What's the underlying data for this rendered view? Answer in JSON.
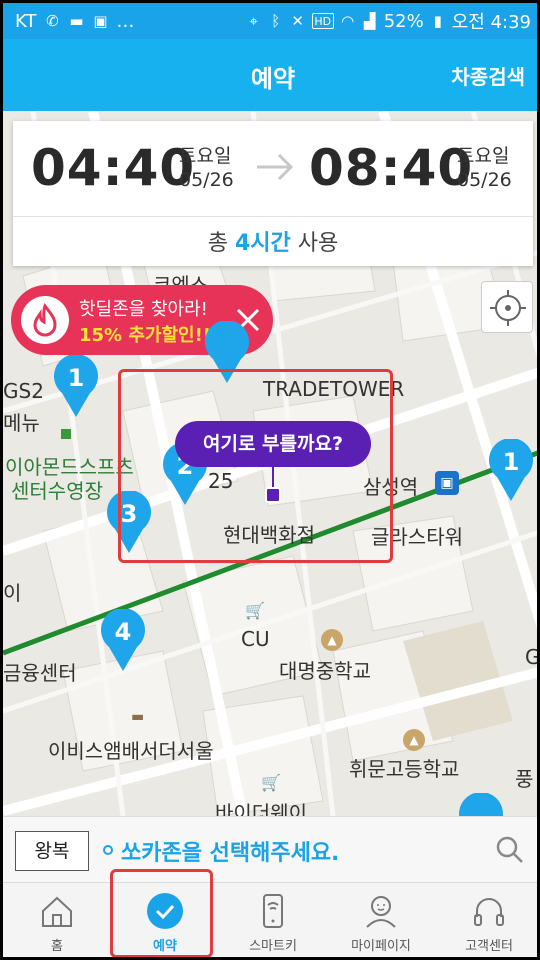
{
  "status_bar": {
    "carrier": "KT",
    "battery": "52%",
    "time": "오전 4:39"
  },
  "header": {
    "title": "예약",
    "search_label": "차종검색"
  },
  "reservation": {
    "start_time": "04:40",
    "start_day": "토요일",
    "start_date": "05/26",
    "end_time": "08:40",
    "end_day": "토요일",
    "end_date": "05/26",
    "total_prefix": "총 ",
    "total_hours": "4시간",
    "total_suffix": " 사용"
  },
  "promo": {
    "line1": "핫딜존을 찾아라!",
    "line2": "15% 추가할인!!"
  },
  "map": {
    "labels": {
      "tradetower": "TRADETOWER",
      "samsung_station": "삼성역",
      "hyundai_dept": "현대백화점",
      "glass_tower": "글라스타워",
      "diamond_center_1": "이아몬드스프츠",
      "diamond_center_2": "센터수영장",
      "cu": "CU",
      "daemyung_school": "대명중학교",
      "ibis": "이비스앰배서더서울",
      "whimun_school": "휘문고등학교",
      "finance_center": "금융센터",
      "coex": "코엑스",
      "baider": "바이더웨이",
      "gs": "GS2",
      "menu": "메뉴",
      "partial_25": "25",
      "partial_i": "이",
      "partial_pung": "풍",
      "partial_g": "G"
    },
    "call_tooltip": "여기로 부를까요?",
    "pins": [
      {
        "number": "1"
      },
      {
        "number": "2"
      },
      {
        "number": "3"
      },
      {
        "number": "4"
      },
      {
        "number": "1"
      }
    ]
  },
  "find_bar": {
    "roundtrip_label": "왕복",
    "prompt": "쏘카존을 선택해주세요."
  },
  "tabs": [
    {
      "label": "홈",
      "icon": "home-icon"
    },
    {
      "label": "예약",
      "icon": "check-circle-icon",
      "active": true
    },
    {
      "label": "스마트키",
      "icon": "smartkey-icon"
    },
    {
      "label": "마이페이지",
      "icon": "person-icon"
    },
    {
      "label": "고객센터",
      "icon": "headset-icon"
    }
  ],
  "colors": {
    "primary": "#17b1f0",
    "promo": "#e63357",
    "promo_highlight": "#ffe13b",
    "tooltip": "#5a1fb3",
    "subway_line": "#1f8a2e",
    "highlight_box": "#e23b3b"
  }
}
